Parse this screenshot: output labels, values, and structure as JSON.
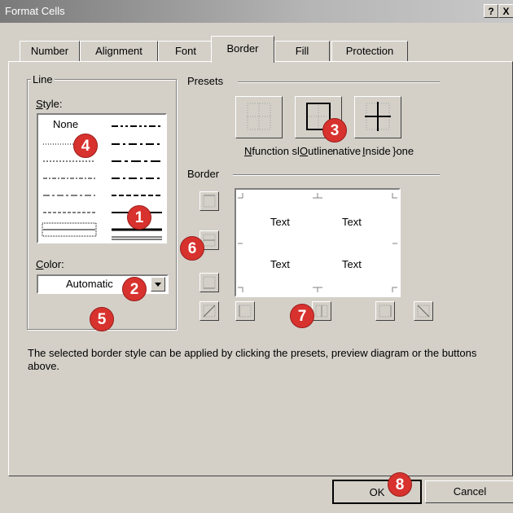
{
  "window": {
    "title": "Format Cells",
    "help_label": "?",
    "close_label": "X"
  },
  "tabs": [
    {
      "label": "Number"
    },
    {
      "label": "Alignment"
    },
    {
      "label": "Font"
    },
    {
      "label": "Border"
    },
    {
      "label": "Fill"
    },
    {
      "label": "Protection"
    }
  ],
  "line_group": {
    "label": "Line",
    "style_label": "Style:",
    "none_label": "None",
    "color_label": "Color:",
    "color_value": "Automatic"
  },
  "presets": {
    "label": "Presets",
    "items": [
      {
        "label": "None"
      },
      {
        "label": "Outline"
      },
      {
        "label": "Inside"
      }
    ]
  },
  "border": {
    "label": "Border",
    "preview_texts": [
      "Text",
      "Text",
      "Text",
      "Text"
    ]
  },
  "hint": "The selected border style can be applied by clicking the presets, preview diagram or the buttons above.",
  "footer": {
    "ok_label": "OK",
    "cancel_label": "Cancel"
  },
  "markers": [
    "1",
    "2",
    "3",
    "4",
    "5",
    "6",
    "7",
    "8"
  ],
  "colors": {
    "marker": "#d8322e",
    "dialog": "#d4d0c8",
    "titlebar": "#8a8a8a"
  }
}
